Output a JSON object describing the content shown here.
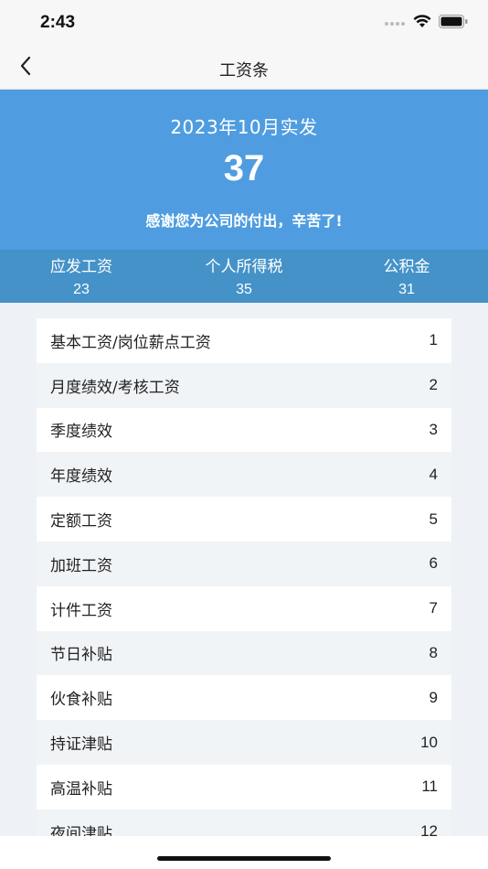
{
  "status_bar": {
    "time": "2:43",
    "icons": [
      "signal-icon",
      "wifi-icon",
      "battery-icon"
    ]
  },
  "nav": {
    "title": "工资条",
    "back_icon": "chevron-left-icon"
  },
  "banner": {
    "month_label": "2023年10月实发",
    "amount": "37",
    "message": "感谢您为公司的付出，辛苦了!",
    "background_color": "#4f9de0"
  },
  "summary": [
    {
      "label": "应发工资",
      "value": "23"
    },
    {
      "label": "个人所得税",
      "value": "35"
    },
    {
      "label": "公积金",
      "value": "31"
    }
  ],
  "items": [
    {
      "label": "基本工资/岗位薪点工资",
      "value": "1"
    },
    {
      "label": "月度绩效/考核工资",
      "value": "2"
    },
    {
      "label": "季度绩效",
      "value": "3"
    },
    {
      "label": "年度绩效",
      "value": "4"
    },
    {
      "label": "定额工资",
      "value": "5"
    },
    {
      "label": "加班工资",
      "value": "6"
    },
    {
      "label": "计件工资",
      "value": "7"
    },
    {
      "label": "节日补贴",
      "value": "8"
    },
    {
      "label": "伙食补贴",
      "value": "9"
    },
    {
      "label": "持证津贴",
      "value": "10"
    },
    {
      "label": "高温补贴",
      "value": "11"
    },
    {
      "label": "夜间津贴",
      "value": "12"
    }
  ]
}
